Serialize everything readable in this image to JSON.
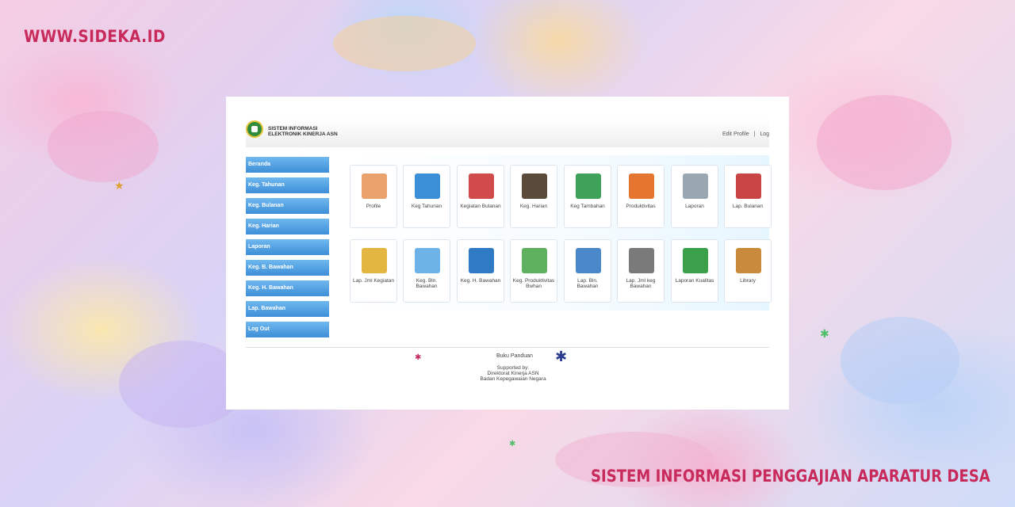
{
  "brand": "WWW.SIDEKA.ID",
  "footer_title": "SISTEM INFORMASI PENGGAJIAN APARATUR DESA",
  "app": {
    "title_line1": "SISTEM INFORMASI",
    "title_line2": "ELEKTRONIK KINERJA ASN",
    "edit_profile": "Edit Profile",
    "separator": "|",
    "logout": "Log"
  },
  "sidebar": {
    "items": [
      {
        "label": "Beranda"
      },
      {
        "label": "Keg. Tahunan"
      },
      {
        "label": "Keg. Bulanan"
      },
      {
        "label": "Keg. Harian"
      },
      {
        "label": "Laporan"
      },
      {
        "label": "Keg. B. Bawahan"
      },
      {
        "label": "Keg. H. Bawahan"
      },
      {
        "label": "Lap. Bawahan"
      },
      {
        "label": "Log Out"
      }
    ]
  },
  "tiles": [
    {
      "label": "Profile",
      "icon": "users-icon",
      "color": "#e9a26b"
    },
    {
      "label": "Keg Tahunan",
      "icon": "arrow-icon",
      "color": "#3a8fd6"
    },
    {
      "label": "Kegiatan Bulanan",
      "icon": "calendar-icon",
      "color": "#d24b4b"
    },
    {
      "label": "Keg. Harian",
      "icon": "address-book-icon",
      "color": "#5a4a3a"
    },
    {
      "label": "Keg Tambahan",
      "icon": "envelope-icon",
      "color": "#3fa25a"
    },
    {
      "label": "Produktivitas",
      "icon": "apps-icon",
      "color": "#e5762f"
    },
    {
      "label": "Laporan",
      "icon": "document-pen-icon",
      "color": "#9aa7b3"
    },
    {
      "label": "Lap. Bulanan",
      "icon": "report-pen-icon",
      "color": "#c94444"
    },
    {
      "label": "Lap. Jml Kegiatan",
      "icon": "notes-pencil-icon",
      "color": "#e2b640"
    },
    {
      "label": "Keg. Bln. Bawahan",
      "icon": "calendar-blue-icon",
      "color": "#6eb3e8"
    },
    {
      "label": "Keg. H. Bawahan",
      "icon": "monitor-icon",
      "color": "#2f7cc4"
    },
    {
      "label": "Keg. Produktivitas Bwhan",
      "icon": "cubes-icon",
      "color": "#5fb15f"
    },
    {
      "label": "Lap. Bln. Bawahan",
      "icon": "chart-document-icon",
      "color": "#4b88c9"
    },
    {
      "label": "Lap. Jml keg Bawahan",
      "icon": "magnifier-chart-icon",
      "color": "#7a7a7a"
    },
    {
      "label": "Laporan Kualitas",
      "icon": "bar-chart-icon",
      "color": "#3aa04a"
    },
    {
      "label": "Library",
      "icon": "book-icon",
      "color": "#c98a3c"
    }
  ],
  "footer": {
    "guide": "Buku Panduan",
    "supported_by": "Supported by:",
    "org1": "Direktorat Kinerja ASN",
    "org2": "Badan Kepegawaian Negara"
  },
  "colors": {
    "brand": "#c72a5b",
    "sidebar": "#4a98dc"
  }
}
